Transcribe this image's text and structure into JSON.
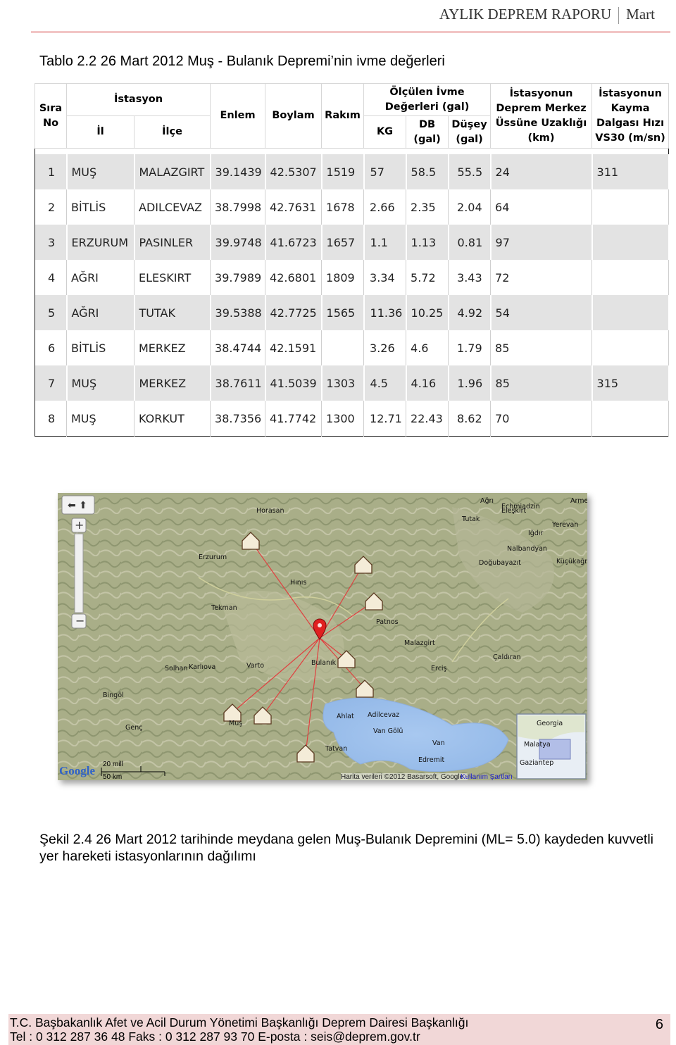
{
  "header": {
    "title": "AYLIK DEPREM RAPORU",
    "month": "Mart"
  },
  "table_caption": "Tablo 2.2 26 Mart  2012 Muş - Bulanık Depremi’nin ivme değerleri",
  "table": {
    "headers": {
      "sira": "Sıra No",
      "istasyon": "İstasyon",
      "il": "İl",
      "ilce": "İlçe",
      "enlem": "Enlem",
      "boylam": "Boylam",
      "rakim": "Rakım",
      "olculen": "Ölçülen İvme Değerleri (gal)",
      "kg": "KG",
      "db": "DB (gal)",
      "dusey": "Düşey (gal)",
      "uzaklik": "İstasyonun Deprem Merkez Üssüne Uzaklığı (km)",
      "vs30": "İstasyonun Kayma Dalgası Hızı VS30 (m/sn)"
    },
    "rows": [
      [
        "1",
        "MUŞ",
        "MALAZGIRT",
        "39.1439",
        "42.5307",
        "1519",
        "57",
        "58.5",
        "55.5",
        "24",
        "311"
      ],
      [
        "2",
        "BİTLİS",
        "ADILCEVAZ",
        "38.7998",
        "42.7631",
        "1678",
        "2.66",
        "2.35",
        "2.04",
        "64",
        ""
      ],
      [
        "3",
        "ERZURUM",
        "PASINLER",
        "39.9748",
        "41.6723",
        "1657",
        "1.1",
        "1.13",
        "0.81",
        "97",
        ""
      ],
      [
        "4",
        "AĞRI",
        "ELESKIRT",
        "39.7989",
        "42.6801",
        "1809",
        "3.34",
        "5.72",
        "3.43",
        "72",
        ""
      ],
      [
        "5",
        "AĞRI",
        "TUTAK",
        "39.5388",
        "42.7725",
        "1565",
        "11.36",
        "10.25",
        "4.92",
        "54",
        ""
      ],
      [
        "6",
        "BİTLİS",
        "MERKEZ",
        "38.4744",
        "42.1591",
        "",
        "3.26",
        "4.6",
        "1.79",
        "85",
        ""
      ],
      [
        "7",
        "MUŞ",
        "MERKEZ",
        "38.7611",
        "41.5039",
        "1303",
        "4.5",
        "4.16",
        "1.96",
        "85",
        "315"
      ],
      [
        "8",
        "MUŞ",
        "KORKUT",
        "38.7356",
        "41.7742",
        "1300",
        "12.71",
        "22.43",
        "8.62",
        "70",
        ""
      ]
    ]
  },
  "map": {
    "places": [
      "Erzurum",
      "Tekman",
      "Hınıs",
      "Bulanık",
      "Patnos",
      "Malazgirt",
      "Erciş",
      "Çaldıran",
      "Bingöl",
      "Genç",
      "Muş",
      "Ahlat",
      "Adilcevaz",
      "Van Gölü",
      "Tatvan",
      "Edremit",
      "Van",
      "Karlıova",
      "Varto",
      "Solhan",
      "Iğdır",
      "Yerevan",
      "Küçükağrı Dağı",
      "Doğubayazıt",
      "Tutak",
      "Eleşkirt",
      "Horasan",
      "Nalbandyan",
      "Echmiadzin",
      "Armeni",
      "Georgia",
      "Gaziantep",
      "Malatya",
      "Ağrı"
    ],
    "scale_mi": "20 mill",
    "scale_km": "50 km",
    "logo": "Google",
    "attribution": "Harita verileri ©2012 Basarsoft, Google -",
    "terms": "Kullanım Şartları",
    "accent_line": "#e04040",
    "epicenter_color": "#e02020"
  },
  "figure_caption": "Şekil 2.4 26 Mart 2012 tarihinde meydana gelen Muş-Bulanık Depremini (ML= 5.0) kaydeden kuvvetli yer hareketi istasyonlarının dağılımı",
  "footer": {
    "line1": "T.C. Başbakanlık Afet ve Acil Durum Yönetimi Başkanlığı Deprem Dairesi Başkanlığı",
    "line2": "Tel : 0 312 287 36 48 Faks : 0 312 287 93 70 E-posta : seis@deprem.gov.tr",
    "page": "6"
  }
}
